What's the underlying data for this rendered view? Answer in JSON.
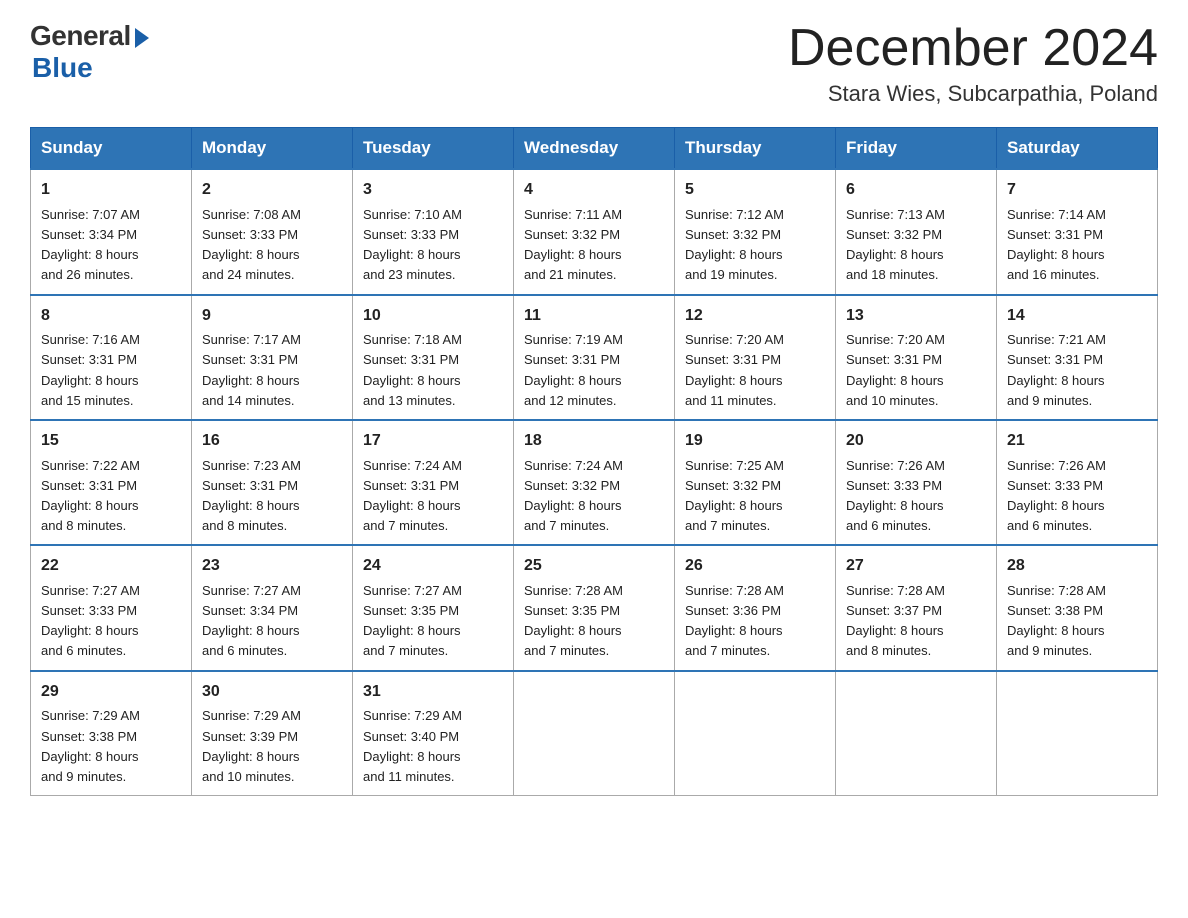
{
  "header": {
    "logo_general": "General",
    "logo_blue": "Blue",
    "month_title": "December 2024",
    "location": "Stara Wies, Subcarpathia, Poland"
  },
  "days_of_week": [
    "Sunday",
    "Monday",
    "Tuesday",
    "Wednesday",
    "Thursday",
    "Friday",
    "Saturday"
  ],
  "weeks": [
    [
      {
        "day": "1",
        "sunrise": "7:07 AM",
        "sunset": "3:34 PM",
        "daylight": "8 hours and 26 minutes."
      },
      {
        "day": "2",
        "sunrise": "7:08 AM",
        "sunset": "3:33 PM",
        "daylight": "8 hours and 24 minutes."
      },
      {
        "day": "3",
        "sunrise": "7:10 AM",
        "sunset": "3:33 PM",
        "daylight": "8 hours and 23 minutes."
      },
      {
        "day": "4",
        "sunrise": "7:11 AM",
        "sunset": "3:32 PM",
        "daylight": "8 hours and 21 minutes."
      },
      {
        "day": "5",
        "sunrise": "7:12 AM",
        "sunset": "3:32 PM",
        "daylight": "8 hours and 19 minutes."
      },
      {
        "day": "6",
        "sunrise": "7:13 AM",
        "sunset": "3:32 PM",
        "daylight": "8 hours and 18 minutes."
      },
      {
        "day": "7",
        "sunrise": "7:14 AM",
        "sunset": "3:31 PM",
        "daylight": "8 hours and 16 minutes."
      }
    ],
    [
      {
        "day": "8",
        "sunrise": "7:16 AM",
        "sunset": "3:31 PM",
        "daylight": "8 hours and 15 minutes."
      },
      {
        "day": "9",
        "sunrise": "7:17 AM",
        "sunset": "3:31 PM",
        "daylight": "8 hours and 14 minutes."
      },
      {
        "day": "10",
        "sunrise": "7:18 AM",
        "sunset": "3:31 PM",
        "daylight": "8 hours and 13 minutes."
      },
      {
        "day": "11",
        "sunrise": "7:19 AM",
        "sunset": "3:31 PM",
        "daylight": "8 hours and 12 minutes."
      },
      {
        "day": "12",
        "sunrise": "7:20 AM",
        "sunset": "3:31 PM",
        "daylight": "8 hours and 11 minutes."
      },
      {
        "day": "13",
        "sunrise": "7:20 AM",
        "sunset": "3:31 PM",
        "daylight": "8 hours and 10 minutes."
      },
      {
        "day": "14",
        "sunrise": "7:21 AM",
        "sunset": "3:31 PM",
        "daylight": "8 hours and 9 minutes."
      }
    ],
    [
      {
        "day": "15",
        "sunrise": "7:22 AM",
        "sunset": "3:31 PM",
        "daylight": "8 hours and 8 minutes."
      },
      {
        "day": "16",
        "sunrise": "7:23 AM",
        "sunset": "3:31 PM",
        "daylight": "8 hours and 8 minutes."
      },
      {
        "day": "17",
        "sunrise": "7:24 AM",
        "sunset": "3:31 PM",
        "daylight": "8 hours and 7 minutes."
      },
      {
        "day": "18",
        "sunrise": "7:24 AM",
        "sunset": "3:32 PM",
        "daylight": "8 hours and 7 minutes."
      },
      {
        "day": "19",
        "sunrise": "7:25 AM",
        "sunset": "3:32 PM",
        "daylight": "8 hours and 7 minutes."
      },
      {
        "day": "20",
        "sunrise": "7:26 AM",
        "sunset": "3:33 PM",
        "daylight": "8 hours and 6 minutes."
      },
      {
        "day": "21",
        "sunrise": "7:26 AM",
        "sunset": "3:33 PM",
        "daylight": "8 hours and 6 minutes."
      }
    ],
    [
      {
        "day": "22",
        "sunrise": "7:27 AM",
        "sunset": "3:33 PM",
        "daylight": "8 hours and 6 minutes."
      },
      {
        "day": "23",
        "sunrise": "7:27 AM",
        "sunset": "3:34 PM",
        "daylight": "8 hours and 6 minutes."
      },
      {
        "day": "24",
        "sunrise": "7:27 AM",
        "sunset": "3:35 PM",
        "daylight": "8 hours and 7 minutes."
      },
      {
        "day": "25",
        "sunrise": "7:28 AM",
        "sunset": "3:35 PM",
        "daylight": "8 hours and 7 minutes."
      },
      {
        "day": "26",
        "sunrise": "7:28 AM",
        "sunset": "3:36 PM",
        "daylight": "8 hours and 7 minutes."
      },
      {
        "day": "27",
        "sunrise": "7:28 AM",
        "sunset": "3:37 PM",
        "daylight": "8 hours and 8 minutes."
      },
      {
        "day": "28",
        "sunrise": "7:28 AM",
        "sunset": "3:38 PM",
        "daylight": "8 hours and 9 minutes."
      }
    ],
    [
      {
        "day": "29",
        "sunrise": "7:29 AM",
        "sunset": "3:38 PM",
        "daylight": "8 hours and 9 minutes."
      },
      {
        "day": "30",
        "sunrise": "7:29 AM",
        "sunset": "3:39 PM",
        "daylight": "8 hours and 10 minutes."
      },
      {
        "day": "31",
        "sunrise": "7:29 AM",
        "sunset": "3:40 PM",
        "daylight": "8 hours and 11 minutes."
      },
      null,
      null,
      null,
      null
    ]
  ],
  "labels": {
    "sunrise": "Sunrise:",
    "sunset": "Sunset:",
    "daylight": "Daylight:"
  }
}
